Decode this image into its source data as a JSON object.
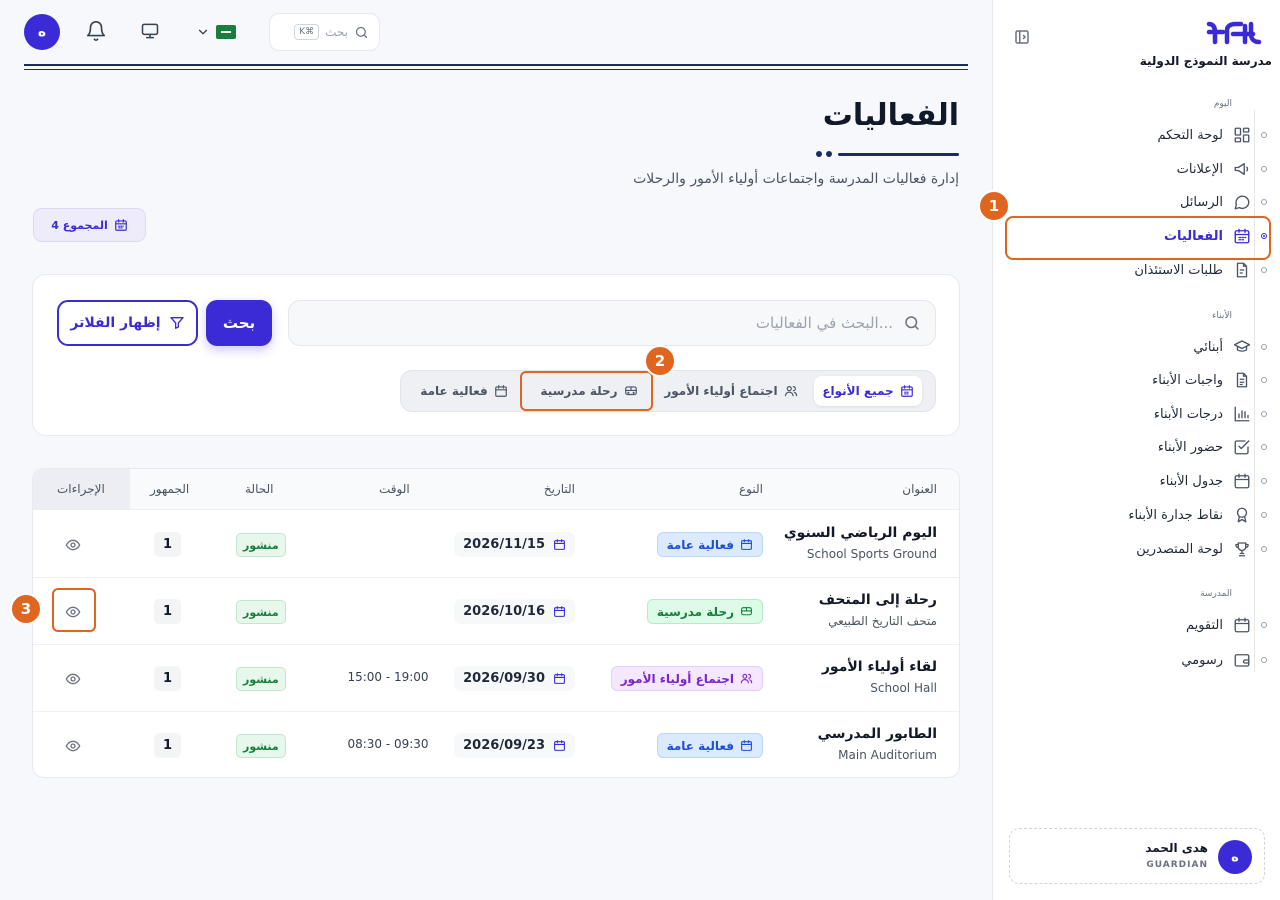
{
  "topbar": {
    "avatar_initial": "ه",
    "search_placeholder": "بحث",
    "search_shortcut": "K⌘",
    "icons": [
      "bell-icon",
      "monitor-icon",
      "chevron-down-icon",
      "saudi-flag-icon",
      "search-icon"
    ]
  },
  "sidebar": {
    "school_name": "مدرسة النموذج الدولية",
    "sections": {
      "today": "اليوم",
      "children": "الأبناء",
      "school": "المدرسة"
    },
    "items": [
      {
        "label": "لوحة التحكم",
        "icon": "dashboard-icon"
      },
      {
        "label": "الإعلانات",
        "icon": "megaphone-icon"
      },
      {
        "label": "الرسائل",
        "icon": "message-icon"
      },
      {
        "label": "الفعاليات",
        "icon": "calendar-icon",
        "active": true
      },
      {
        "label": "طلبات الاستئذان",
        "icon": "document-icon"
      },
      {
        "label": "أبنائي",
        "icon": "graduation-cap-icon"
      },
      {
        "label": "واجبات الأبناء",
        "icon": "file-text-icon"
      },
      {
        "label": "درجات الأبناء",
        "icon": "bar-chart-icon"
      },
      {
        "label": "حضور الأبناء",
        "icon": "check-square-icon"
      },
      {
        "label": "جدول الأبناء",
        "icon": "calendar-icon"
      },
      {
        "label": "نقاط جدارة الأبناء",
        "icon": "award-icon"
      },
      {
        "label": "لوحة المتصدرين",
        "icon": "trophy-icon"
      },
      {
        "label": "التقويم",
        "icon": "calendar-icon"
      },
      {
        "label": "رسومي",
        "icon": "wallet-icon"
      }
    ],
    "user": {
      "initial": "ه",
      "name": "هدى الحمد",
      "role": "GUARDIAN"
    }
  },
  "page": {
    "title": "الفعاليات",
    "subtitle": "إدارة فعاليات المدرسة واجتماعات أولياء الأمور والرحلات",
    "total_badge": "4 المجموع"
  },
  "filters": {
    "search_placeholder": "البحث في الفعاليات...",
    "search_button": "بحث",
    "show_filters_button": "إظهار الفلاتر",
    "tabs": [
      {
        "label": "جميع الأنواع",
        "active": true
      },
      {
        "label": "اجتماع أولياء الأمور"
      },
      {
        "label": "رحلة مدرسية"
      },
      {
        "label": "فعالية عامة"
      }
    ]
  },
  "table": {
    "headers": {
      "title": "العنوان",
      "type": "النوع",
      "date": "التاريخ",
      "time": "الوقت",
      "status": "الحالة",
      "audience": "الجمهور",
      "actions": "الإجراءات"
    },
    "rows": [
      {
        "title": "اليوم الرياضي السنوي",
        "location": "School Sports Ground",
        "type": "فعالية عامة",
        "date": "2026/11/15",
        "time": "",
        "status": "منشور",
        "audience": "1"
      },
      {
        "title": "رحلة إلى المتحف",
        "location": "متحف التاريخ الطبيعي",
        "type": "رحلة مدرسية",
        "date": "2026/10/16",
        "time": "",
        "status": "منشور",
        "audience": "1"
      },
      {
        "title": "لقاء أولياء الأمور",
        "location": "School Hall",
        "type": "اجتماع أولياء الأمور",
        "date": "2026/09/30",
        "time": "15:00 - 19:00",
        "status": "منشور",
        "audience": "1"
      },
      {
        "title": "الطابور المدرسي",
        "location": "Main Auditorium",
        "type": "فعالية عامة",
        "date": "2026/09/23",
        "time": "08:30 - 09:30",
        "status": "منشور",
        "audience": "1"
      }
    ]
  },
  "markers": [
    "1",
    "2",
    "3"
  ],
  "colors": {
    "primary": "#3b2bd6",
    "navy": "#1e2b5e",
    "highlight": "#e0651f",
    "published_bg": "#e7f7ec",
    "published_text": "#15803d",
    "general_event_bg": "#dbeafe",
    "general_event_text": "#1d4ed8",
    "school_trip_bg": "#dcfce7",
    "school_trip_text": "#15803d",
    "parents_meeting_bg": "#f3e8ff",
    "parents_meeting_text": "#7e22ce"
  }
}
